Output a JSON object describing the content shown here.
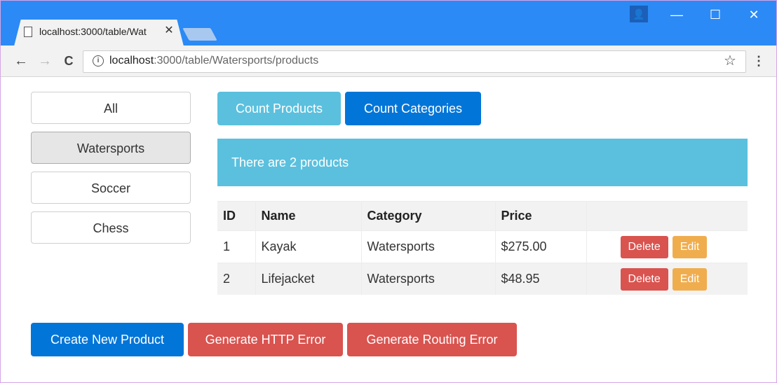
{
  "browser": {
    "tab_title": "localhost:3000/table/Wat",
    "tab_close": "✕",
    "url_host": "localhost",
    "url_path": ":3000/table/Watersports/products",
    "win_minimize": "—",
    "win_maximize": "☐",
    "win_close": "✕",
    "profile": "👤",
    "back": "←",
    "forward": "→",
    "reload": "C",
    "info": "i",
    "star": "☆",
    "menu": "⋮"
  },
  "sidebar": {
    "items": [
      {
        "label": "All",
        "active": false
      },
      {
        "label": "Watersports",
        "active": true
      },
      {
        "label": "Soccer",
        "active": false
      },
      {
        "label": "Chess",
        "active": false
      }
    ]
  },
  "toolbar": {
    "count_products": "Count Products",
    "count_categories": "Count Categories"
  },
  "alert": {
    "text": "There are 2 products"
  },
  "table": {
    "headers": [
      "ID",
      "Name",
      "Category",
      "Price",
      ""
    ],
    "rows": [
      {
        "id": "1",
        "name": "Kayak",
        "category": "Watersports",
        "price": "$275.00"
      },
      {
        "id": "2",
        "name": "Lifejacket",
        "category": "Watersports",
        "price": "$48.95"
      }
    ],
    "delete_label": "Delete",
    "edit_label": "Edit"
  },
  "footer": {
    "create": "Create New Product",
    "http_error": "Generate HTTP Error",
    "routing_error": "Generate Routing Error"
  },
  "colors": {
    "titlebar": "#2b8af5",
    "primary": "#0275d8",
    "info": "#5bc0de",
    "danger": "#d9534f",
    "warning": "#f0ad4e"
  }
}
